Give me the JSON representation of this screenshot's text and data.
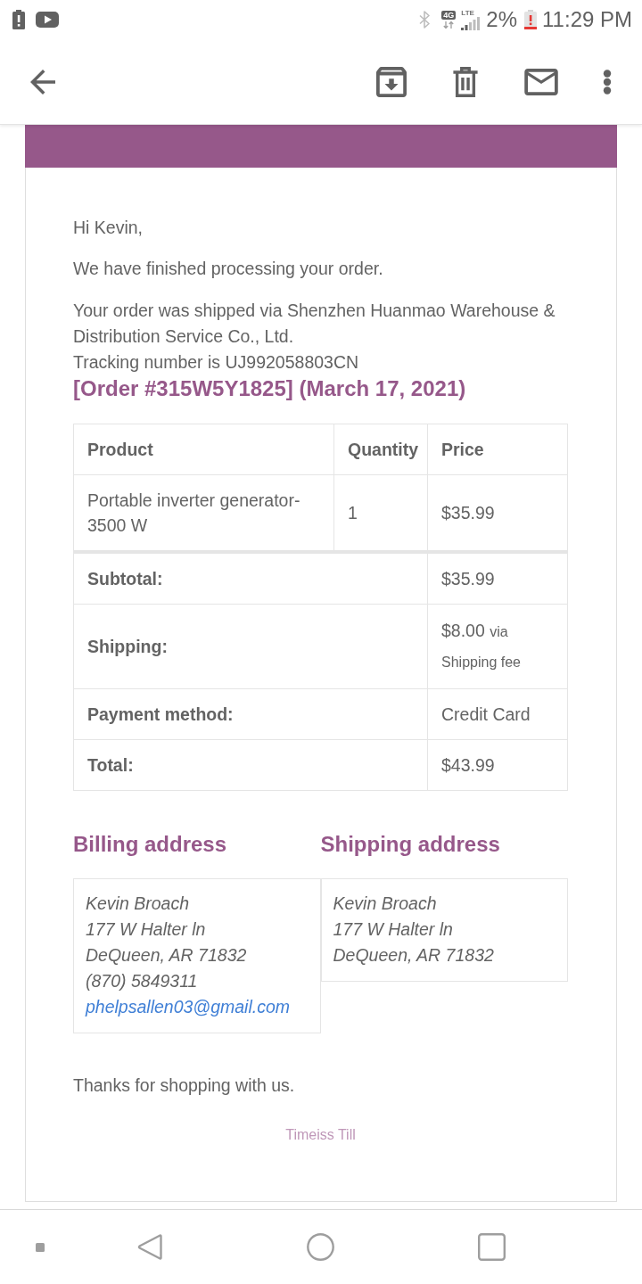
{
  "status_bar": {
    "network_type": "4G",
    "signal_label": "LTE",
    "battery": "2%",
    "time": "11:29 PM"
  },
  "email": {
    "greeting": "Hi Kevin,",
    "intro": "We have finished processing your order.",
    "shipped_via": "Your order was shipped via Shenzhen Huanmao Warehouse & Distribution Service Co., Ltd.",
    "tracking": "Tracking number is UJ992058803CN",
    "order_heading": "[Order #315W5Y1825] (March 17, 2021)",
    "order_table": {
      "columns": [
        "Product",
        "Quantity",
        "Price"
      ],
      "rows": [
        {
          "product": "Portable inverter generator-3500 W",
          "quantity": "1",
          "price": "$35.99"
        }
      ],
      "totals": [
        {
          "label": "Subtotal:",
          "value": "$35.99"
        },
        {
          "label": "Shipping:",
          "value": "$8.00",
          "note": "via Shipping fee"
        },
        {
          "label": "Payment method:",
          "value": "Credit Card"
        },
        {
          "label": "Total:",
          "value": "$43.99"
        }
      ]
    },
    "addresses": [
      {
        "heading": "Billing address",
        "lines": [
          "Kevin Broach",
          "177 W Halter ln",
          "DeQueen, AR 71832",
          "(870) 5849311"
        ],
        "email": "phelpsallen03@gmail.com"
      },
      {
        "heading": "Shipping address",
        "lines": [
          "Kevin Broach",
          "177 W Halter ln",
          "DeQueen, AR 71832"
        ]
      }
    ],
    "closing": "Thanks for shopping with us.",
    "footer": "Timeiss Till"
  }
}
